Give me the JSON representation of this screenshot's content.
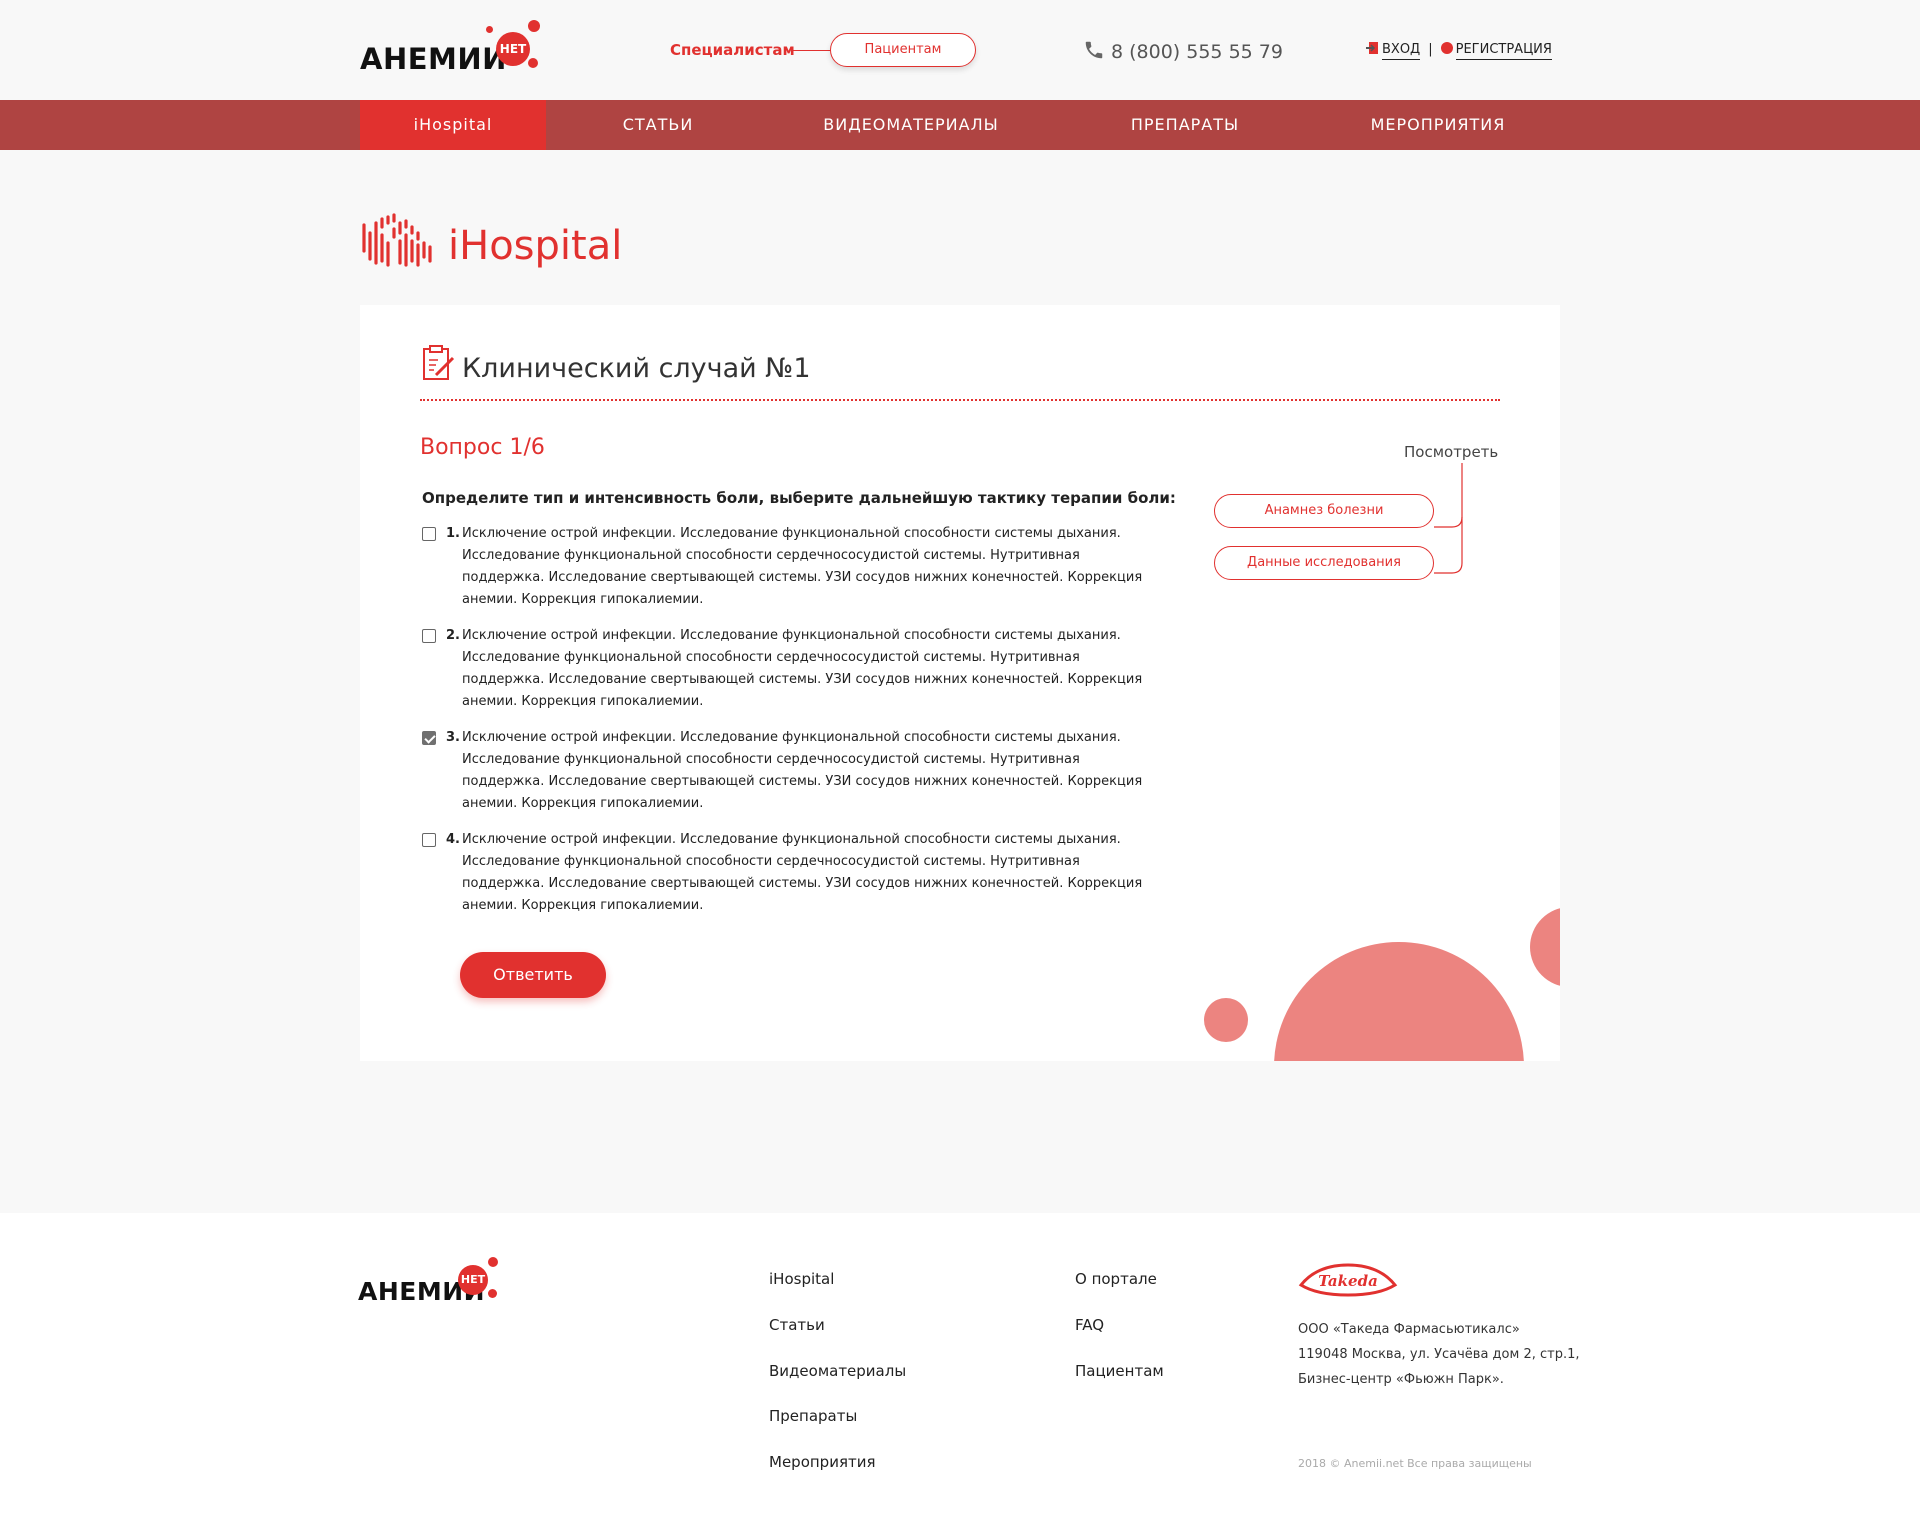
{
  "header": {
    "logo_text": "АНЕМИИ",
    "logo_badge": "НЕТ",
    "audience_specialists": "Специалистам",
    "audience_patients": "Пациентам",
    "phone": "8 (800) 555 55 79",
    "login": "ВХОД",
    "register": "РЕГИСТРАЦИЯ"
  },
  "nav": {
    "items": [
      {
        "label": "iHospital"
      },
      {
        "label": "СТАТЬИ"
      },
      {
        "label": "ВИДЕОМАТЕРИАЛЫ"
      },
      {
        "label": "ПРЕПАРАТЫ"
      },
      {
        "label": "МЕРОПРИЯТИЯ"
      }
    ],
    "active_index": 0
  },
  "brand": {
    "title": "iHospital"
  },
  "case": {
    "title": "Клинический случай №1",
    "question_label": "Вопрос 1/6",
    "question_text": "Определите тип и интенсивность боли, выберите дальнейшую тактику терапии боли:",
    "options": [
      {
        "num": "1.",
        "text": "Исключение острой инфекции. Исследование функциональной способности системы дыхания. Исследование функциональной способности сердечнососудистой системы. Нутритивная поддержка. Исследование свертывающей системы. УЗИ сосудов нижних конечностей. Коррекция анемии. Коррекция гипокалиемии.",
        "checked": false
      },
      {
        "num": "2.",
        "text": "Исключение острой инфекции. Исследование функциональной способности системы дыхания. Исследование функциональной способности сердечнососудистой системы. Нутритивная поддержка. Исследование свертывающей системы. УЗИ сосудов нижних конечностей. Коррекция анемии. Коррекция гипокалиемии.",
        "checked": false
      },
      {
        "num": "3.",
        "text": "Исключение острой инфекции. Исследование функциональной способности системы дыхания. Исследование функциональной способности сердечнососудистой системы. Нутритивная поддержка. Исследование свертывающей системы. УЗИ сосудов нижних конечностей. Коррекция анемии. Коррекция гипокалиемии.",
        "checked": true
      },
      {
        "num": "4.",
        "text": "Исключение острой инфекции. Исследование функциональной способности системы дыхания. Исследование функциональной способности сердечнососудистой системы. Нутритивная поддержка. Исследование свертывающей системы. УЗИ сосудов нижних конечностей. Коррекция анемии. Коррекция гипокалиемии.",
        "checked": false
      }
    ],
    "answer_button": "Ответить",
    "view_label": "Посмотреть",
    "side_buttons": [
      "Анамнез болезни",
      "Данные исследования"
    ]
  },
  "footer": {
    "logo_text": "АНЕМИИ",
    "logo_badge": "НЕТ",
    "col1": [
      "iHospital",
      "Статьи",
      "Видеоматериалы",
      "Препараты",
      "Мероприятия"
    ],
    "col2": [
      "О портале",
      "FAQ",
      "Пациентам"
    ],
    "company_logo": "Takeda",
    "address_lines": [
      "ООО «Такеда Фармасьютикалс»",
      "119048 Москва, ул. Усачёва дом 2, стр.1,",
      "Бизнес-центр «Фьюжн Парк»."
    ],
    "copyright": "2018 © Anemii.net Все права защищены"
  },
  "colors": {
    "accent": "#e1312f",
    "nav_bg": "#af4442",
    "circle": "#ec8480"
  }
}
